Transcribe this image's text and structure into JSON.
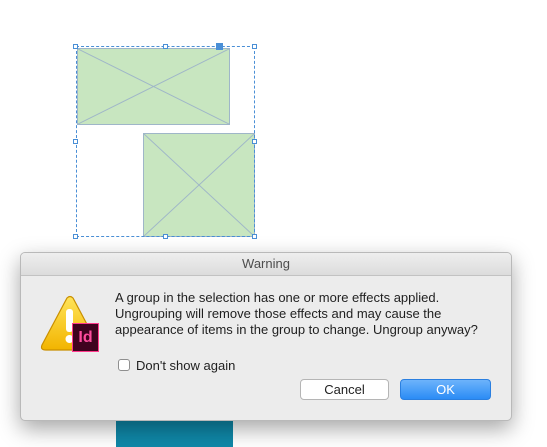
{
  "dialog": {
    "title": "Warning",
    "message": "A group in the selection has one or more effects applied. Ungrouping will remove those effects and may cause the appearance of items in the group to change. Ungroup anyway?",
    "app_icon_text": "Id",
    "checkbox": {
      "label": "Don't show again",
      "checked": false
    },
    "buttons": {
      "cancel": "Cancel",
      "ok": "OK"
    }
  },
  "colors": {
    "frame_fill": "#c8e6c0",
    "selection": "#4a8fd6",
    "default_button": "#2b8cf5",
    "teal_object": "#0f88a8"
  },
  "icons": [
    "warning-triangle-icon",
    "indesign-app-icon"
  ]
}
